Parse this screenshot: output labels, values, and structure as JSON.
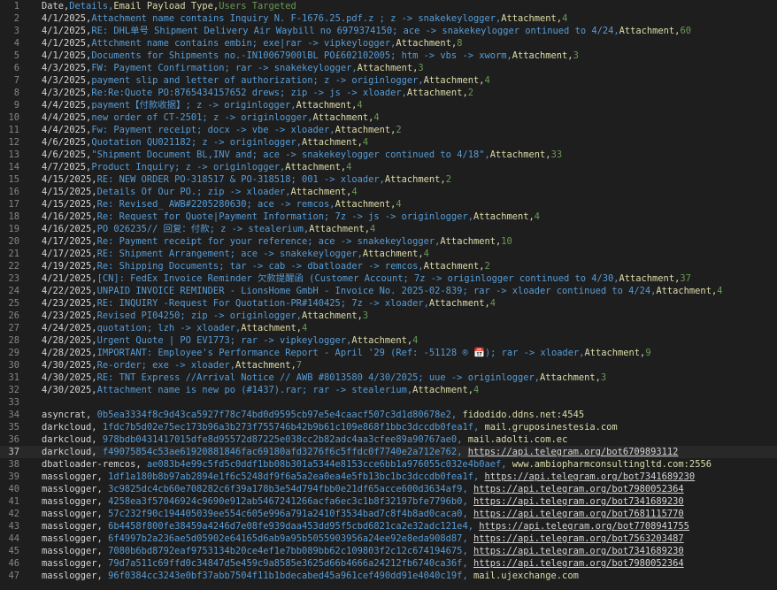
{
  "editor": {
    "current_line": 37,
    "lines": [
      {
        "n": 1,
        "s": [
          [
            "Date,",
            "c0"
          ],
          [
            "Details,",
            "c1"
          ],
          [
            "Email Payload Type,",
            "c2"
          ],
          [
            "Users Targeted",
            "c3"
          ]
        ]
      },
      {
        "n": 2,
        "s": [
          [
            "4/1/2025,",
            "c0"
          ],
          [
            "Attachment name contains Inquiry N. F-1676.25.pdf.z ; z -> snakekeylogger,",
            "c1"
          ],
          [
            "Attachment,",
            "c2"
          ],
          [
            "4",
            "c3"
          ]
        ]
      },
      {
        "n": 3,
        "s": [
          [
            "4/1/2025,",
            "c0"
          ],
          [
            "RE: DHL单号 Shipment Delivery Air Waybill no 6979374150; ace -> snakekeylogger ontinued to 4/24,",
            "c1"
          ],
          [
            "Attachment,",
            "c2"
          ],
          [
            "60",
            "c3"
          ]
        ]
      },
      {
        "n": 4,
        "s": [
          [
            "4/1/2025,",
            "c0"
          ],
          [
            "Attchment name contains embin; exe|rar -> vipkeylogger,",
            "c1"
          ],
          [
            "Attachment,",
            "c2"
          ],
          [
            "8",
            "c3"
          ]
        ]
      },
      {
        "n": 5,
        "s": [
          [
            "4/1/2025,",
            "c0"
          ],
          [
            "Documents for Shipments no.-IN10067900lBL PO£602102005; htm -> vbs -> xworm,",
            "c1"
          ],
          [
            "Attachment,",
            "c2"
          ],
          [
            "3",
            "c3"
          ]
        ]
      },
      {
        "n": 6,
        "s": [
          [
            "4/3/2025,",
            "c0"
          ],
          [
            "FW: Payment Confirmation; rar -> snakekeylogger,",
            "c1"
          ],
          [
            "Attachment,",
            "c2"
          ],
          [
            "3",
            "c3"
          ]
        ]
      },
      {
        "n": 7,
        "s": [
          [
            "4/3/2025,",
            "c0"
          ],
          [
            "payment slip and letter of authorization; z -> originlogger,",
            "c1"
          ],
          [
            "Attachment,",
            "c2"
          ],
          [
            "4",
            "c3"
          ]
        ]
      },
      {
        "n": 8,
        "s": [
          [
            "4/3/2025,",
            "c0"
          ],
          [
            "Re:Re:Quote PO:8765434157652 drews; zip -> js -> xloader,",
            "c1"
          ],
          [
            "Attachment,",
            "c2"
          ],
          [
            "2",
            "c3"
          ]
        ]
      },
      {
        "n": 9,
        "s": [
          [
            "4/4/2025,",
            "c0"
          ],
          [
            "payment【付款收据】; z -> originlogger,",
            "c1"
          ],
          [
            "Attachment,",
            "c2"
          ],
          [
            "4",
            "c3"
          ]
        ]
      },
      {
        "n": 10,
        "s": [
          [
            "4/4/2025,",
            "c0"
          ],
          [
            "new order of CT-2501; z -> originlogger,",
            "c1"
          ],
          [
            "Attachment,",
            "c2"
          ],
          [
            "4",
            "c3"
          ]
        ]
      },
      {
        "n": 11,
        "s": [
          [
            "4/4/2025,",
            "c0"
          ],
          [
            "Fw: Payment receipt; docx -> vbe -> xloader,",
            "c1"
          ],
          [
            "Attachment,",
            "c2"
          ],
          [
            "2",
            "c3"
          ]
        ]
      },
      {
        "n": 12,
        "s": [
          [
            "4/6/2025,",
            "c0"
          ],
          [
            "Quotation QU021182; z -> originlogger,",
            "c1"
          ],
          [
            "Attachment,",
            "c2"
          ],
          [
            "4",
            "c3"
          ]
        ]
      },
      {
        "n": 13,
        "s": [
          [
            "4/6/2025,",
            "c0"
          ],
          [
            "\"Shipment Document BL,INV and; ace -> snakekeylogger continued to 4/18\",",
            "c1"
          ],
          [
            "Attachment,",
            "c2"
          ],
          [
            "33",
            "c3"
          ]
        ]
      },
      {
        "n": 14,
        "s": [
          [
            "4/7/2025,",
            "c0"
          ],
          [
            "Product Inquiry; z -> originlogger,",
            "c1"
          ],
          [
            "Attachment,",
            "c2"
          ],
          [
            "4",
            "c3"
          ]
        ]
      },
      {
        "n": 15,
        "s": [
          [
            "4/15/2025,",
            "c0"
          ],
          [
            "RE: NEW ORDER PO-318517 & PO-318518; 001 -> xloader,",
            "c1"
          ],
          [
            "Attachment,",
            "c2"
          ],
          [
            "2",
            "c3"
          ]
        ]
      },
      {
        "n": 16,
        "s": [
          [
            "4/15/2025,",
            "c0"
          ],
          [
            "Details Of Our PO.; zip -> xloader,",
            "c1"
          ],
          [
            "Attachment,",
            "c2"
          ],
          [
            "4",
            "c3"
          ]
        ]
      },
      {
        "n": 17,
        "s": [
          [
            "4/15/2025,",
            "c0"
          ],
          [
            "Re: Revised_ AWB#2205280630; ace -> remcos,",
            "c1"
          ],
          [
            "Attachment,",
            "c2"
          ],
          [
            "4",
            "c3"
          ]
        ]
      },
      {
        "n": 18,
        "s": [
          [
            "4/16/2025,",
            "c0"
          ],
          [
            "Re: Request for Quote|Payment Information; 7z -> js -> originlogger,",
            "c1"
          ],
          [
            "Attachment,",
            "c2"
          ],
          [
            "4",
            "c3"
          ]
        ]
      },
      {
        "n": 19,
        "s": [
          [
            "4/16/2025,",
            "c0"
          ],
          [
            "PO 026235// 回复：付款; z -> stealerium,",
            "c1"
          ],
          [
            "Attachment,",
            "c2"
          ],
          [
            "4",
            "c3"
          ]
        ]
      },
      {
        "n": 20,
        "s": [
          [
            "4/17/2025,",
            "c0"
          ],
          [
            "Re: Payment receipt for your reference; ace -> snakekeylogger,",
            "c1"
          ],
          [
            "Attachment,",
            "c2"
          ],
          [
            "10",
            "c3"
          ]
        ]
      },
      {
        "n": 21,
        "s": [
          [
            "4/17/2025,",
            "c0"
          ],
          [
            "RE: Shipment Arrangement; ace -> snakekeylogger,",
            "c1"
          ],
          [
            "Attachment,",
            "c2"
          ],
          [
            "4",
            "c3"
          ]
        ]
      },
      {
        "n": 22,
        "s": [
          [
            "4/19/2025,",
            "c0"
          ],
          [
            "Re: Shipping Documents; tar -> cab -> dbatloader -> remcos,",
            "c1"
          ],
          [
            "Attachment,",
            "c2"
          ],
          [
            "2",
            "c3"
          ]
        ]
      },
      {
        "n": 23,
        "s": [
          [
            "4/21/2025,",
            "c0"
          ],
          [
            "[CN]: FedEx Invoice Reminder 欠款提醒函 (Customer Account; 7z -> originlogger continued to 4/30,",
            "c1"
          ],
          [
            "Attachment,",
            "c2"
          ],
          [
            "37",
            "c3"
          ]
        ]
      },
      {
        "n": 24,
        "s": [
          [
            "4/22/2025,",
            "c0"
          ],
          [
            "UNPAID INVOICE REMINDER - LionsHome GmbH - Invoice No. 2025-02-839; rar -> xloader continued to 4/24,",
            "c1"
          ],
          [
            "Attachment,",
            "c2"
          ],
          [
            "4",
            "c3"
          ]
        ]
      },
      {
        "n": 25,
        "s": [
          [
            "4/23/2025,",
            "c0"
          ],
          [
            "RE: INQUIRY -Request For Quotation-PR#140425; 7z -> xloader,",
            "c1"
          ],
          [
            "Attachment,",
            "c2"
          ],
          [
            "4",
            "c3"
          ]
        ]
      },
      {
        "n": 26,
        "s": [
          [
            "4/23/2025,",
            "c0"
          ],
          [
            "Revised PI04250; zip -> originlogger,",
            "c1"
          ],
          [
            "Attachment,",
            "c2"
          ],
          [
            "3",
            "c3"
          ]
        ]
      },
      {
        "n": 27,
        "s": [
          [
            "4/24/2025,",
            "c0"
          ],
          [
            "quotation; lzh -> xloader,",
            "c1"
          ],
          [
            "Attachment,",
            "c2"
          ],
          [
            "4",
            "c3"
          ]
        ]
      },
      {
        "n": 28,
        "s": [
          [
            "4/28/2025,",
            "c0"
          ],
          [
            "Urgent Quote | PO EV1773; rar -> vipkeylogger,",
            "c1"
          ],
          [
            "Attachment,",
            "c2"
          ],
          [
            "4",
            "c3"
          ]
        ]
      },
      {
        "n": 29,
        "s": [
          [
            "4/28/2025,",
            "c0"
          ],
          [
            "IMPORTANT: Employee's Performance Report - April '29 (Ref: -51128 ® 📅); rar -> xloader,",
            "c1"
          ],
          [
            "Attachment,",
            "c2"
          ],
          [
            "9",
            "c3"
          ]
        ]
      },
      {
        "n": 30,
        "s": [
          [
            "4/30/2025,",
            "c0"
          ],
          [
            "Re-order; exe -> xloader,",
            "c1"
          ],
          [
            "Attachment,",
            "c2"
          ],
          [
            "7",
            "c3"
          ]
        ]
      },
      {
        "n": 31,
        "s": [
          [
            "4/30/2025,",
            "c0"
          ],
          [
            "RE: TNT Express //Arrival Notice // AWB #8013580 4/30/2025; uue -> originlogger,",
            "c1"
          ],
          [
            "Attachment,",
            "c2"
          ],
          [
            "3",
            "c3"
          ]
        ]
      },
      {
        "n": 32,
        "s": [
          [
            "4/30/2025,",
            "c0"
          ],
          [
            "Attachment name is new po (#1437).rar; rar -> stealerium,",
            "c1"
          ],
          [
            "Attachment,",
            "c2"
          ],
          [
            "4",
            "c3"
          ]
        ]
      },
      {
        "n": 33,
        "s": []
      },
      {
        "n": 34,
        "s": [
          [
            "asyncrat, ",
            "c0"
          ],
          [
            "0b5ea3334f8c9d43ca5927f78c74bd0d9595cb97e5e4caacf507c3d1d80678e2, ",
            "c1"
          ],
          [
            "fidodido.ddns.net:4545",
            "c2"
          ]
        ]
      },
      {
        "n": 35,
        "s": [
          [
            "darkcloud, ",
            "c0"
          ],
          [
            "1fdc7b5d02e75ec173b96a3b273f755746b42b9b61c109e868f1bbc3dccdb0fea1f, ",
            "c1"
          ],
          [
            "mail.gruposinestesia.com",
            "c2"
          ]
        ]
      },
      {
        "n": 36,
        "s": [
          [
            "darkcloud, ",
            "c0"
          ],
          [
            "978bdb0431417015dfe8d95572d87225e038cc2b82adc4aa3cfee89a90767ae0, ",
            "c1"
          ],
          [
            "mail.adolti.com.ec",
            "c2"
          ]
        ]
      },
      {
        "n": 37,
        "s": [
          [
            "darkcloud, ",
            "c0"
          ],
          [
            "f49075854c53ae61920881846fac69180afd3276f6c5ffdc0f7740e2a712e762, ",
            "c1"
          ],
          [
            "https://api.telegram.org/bot6709893112",
            "lnk"
          ]
        ]
      },
      {
        "n": 38,
        "s": [
          [
            "dbatloader-remcos, ",
            "c0"
          ],
          [
            "ae083b4e99c5fd5c0ddf1bb08b301a5344e8153cce6bb1a976055c032e4b0aef, ",
            "c1"
          ],
          [
            "www.ambiopharmconsultingltd.com:2556",
            "c2"
          ]
        ]
      },
      {
        "n": 39,
        "s": [
          [
            "masslogger, ",
            "c0"
          ],
          [
            "1df1a180b8b97ab2894e1f6c5248df9f6a5a2ea0ea4e5fb13bc1bc3dccdb0fea1f, ",
            "c1"
          ],
          [
            "https://api.telegram.org/bot7341689230",
            "lnk"
          ]
        ]
      },
      {
        "n": 40,
        "s": [
          [
            "masslogger, ",
            "c0"
          ],
          [
            "3c9825dc4cb60e708282c6f39a178b3e54d794fbb0e21df65acce600d3634af9, ",
            "c1"
          ],
          [
            "https://api.telegram.org/bot7980052364",
            "lnk"
          ]
        ]
      },
      {
        "n": 41,
        "s": [
          [
            "masslogger, ",
            "c0"
          ],
          [
            "4258ea3f57046924c9690e912ab5467241266acfa6ec3c1b8f32197bfe7796b0, ",
            "c1"
          ],
          [
            "https://api.telegram.org/bot7341689230",
            "lnk"
          ]
        ]
      },
      {
        "n": 42,
        "s": [
          [
            "masslogger, ",
            "c0"
          ],
          [
            "57c232f90c194405039ee554c605e996a791a2410f3534bad7c8f4b8ad0caca0, ",
            "c1"
          ],
          [
            "https://api.telegram.org/bot7681115770",
            "lnk"
          ]
        ]
      },
      {
        "n": 43,
        "s": [
          [
            "masslogger, ",
            "c0"
          ],
          [
            "6b4458f800fe38459a4246d7e08fe939daa453dd95f5cbd6821ca2e32adc121e4, ",
            "c1"
          ],
          [
            "https://api.telegram.org/bot7708941755",
            "lnk"
          ]
        ]
      },
      {
        "n": 44,
        "s": [
          [
            "masslogger, ",
            "c0"
          ],
          [
            "6f4997b2a236ae5d05902e64165d6ab9a95b5055903956a24ee92e8eda908d87, ",
            "c1"
          ],
          [
            "https://api.telegram.org/bot7563203487",
            "lnk"
          ]
        ]
      },
      {
        "n": 45,
        "s": [
          [
            "masslogger, ",
            "c0"
          ],
          [
            "7080b6bd8792eaf9753134b20ce4ef1e7bb089bb62c109803f2c12c674194675, ",
            "c1"
          ],
          [
            "https://api.telegram.org/bot7341689230",
            "lnk"
          ]
        ]
      },
      {
        "n": 46,
        "s": [
          [
            "masslogger, ",
            "c0"
          ],
          [
            "79d7a511c69ffd0c34847d5e459c9a8585e3625d66b4666a24212fb6740ca36f, ",
            "c1"
          ],
          [
            "https://api.telegram.org/bot7980052364",
            "lnk"
          ]
        ]
      },
      {
        "n": 47,
        "s": [
          [
            "masslogger, ",
            "c0"
          ],
          [
            "96f0384cc3243e0bf37abb7504f11b1bdecabed45a961cef490dd91e4040c19f, ",
            "c1"
          ],
          [
            "mail.ujexchange.com",
            "c2"
          ]
        ]
      }
    ]
  },
  "colors": {
    "background": "#1e1e1e",
    "col_date": "#d4d4d4",
    "col_details": "#569cd6",
    "col_type": "#dcdcaa",
    "col_users": "#6a9955",
    "line_number": "#858585"
  }
}
